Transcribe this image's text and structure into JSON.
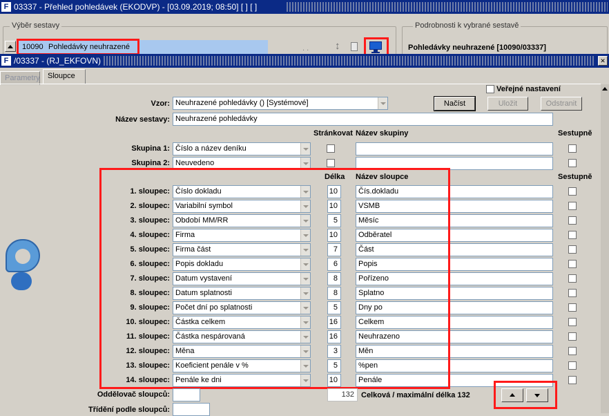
{
  "main_window": {
    "title": "03337 - Přehled pohledávek (EKODVP) - [03.09.2019; 08:50]  [ ]  [ ]"
  },
  "report_select": {
    "label": "Výběr sestavy",
    "code": "10090",
    "name": "Pohledávky neuhrazené"
  },
  "details_panel": {
    "label": "Podrobnosti k vybrané sestavě",
    "title": "Pohledávky neuhrazené [10090/03337]"
  },
  "sub_window": {
    "title": "/03337 - (RJ_EKFOVN)"
  },
  "tabs": [
    {
      "label": "Parametry",
      "active": false
    },
    {
      "label": "Sloupce",
      "active": true
    }
  ],
  "form": {
    "public_settings": "Veřejné nastavení",
    "vzor_label": "Vzor:",
    "vzor_value": "Neuhrazené pohledávky   ()   [Systémové]",
    "btn_load": "Načíst",
    "btn_save": "Uložit",
    "btn_remove": "Odstranit",
    "report_name_label": "Název sestavy:",
    "report_name_value": "Neuhrazené pohledávky",
    "hdr_paging": "Stránkovat",
    "hdr_group_name": "Název skupiny",
    "hdr_desc": "Sestupně",
    "groups": [
      {
        "label": "Skupina 1:",
        "value": "Číslo a název deníku",
        "group_name": ""
      },
      {
        "label": "Skupina 2:",
        "value": "Neuvedeno",
        "group_name": ""
      }
    ],
    "hdr_length": "Délka",
    "hdr_column_name": "Název sloupce",
    "hdr_desc2": "Sestupně",
    "columns": [
      {
        "label": "1. sloupec:",
        "value": "Číslo dokladu",
        "length": "10",
        "name": "Čís.dokladu"
      },
      {
        "label": "2. sloupec:",
        "value": "Variabilní symbol",
        "length": "10",
        "name": "VSMB"
      },
      {
        "label": "3. sloupec:",
        "value": "Období MM/RR",
        "length": "5",
        "name": "Měsíc"
      },
      {
        "label": "4. sloupec:",
        "value": "Firma",
        "length": "10",
        "name": "Odběratel"
      },
      {
        "label": "5. sloupec:",
        "value": "Firma část",
        "length": "7",
        "name": "Část"
      },
      {
        "label": "6. sloupec:",
        "value": "Popis dokladu",
        "length": "6",
        "name": "Popis"
      },
      {
        "label": "7. sloupec:",
        "value": "Datum vystavení",
        "length": "8",
        "name": "Pořízeno"
      },
      {
        "label": "8. sloupec:",
        "value": "Datum splatnosti",
        "length": "8",
        "name": "Splatno"
      },
      {
        "label": "9. sloupec:",
        "value": "Počet dní po splatnosti",
        "length": "5",
        "name": "Dny po"
      },
      {
        "label": "10. sloupec:",
        "value": "Částka celkem",
        "length": "16",
        "name": "Celkem"
      },
      {
        "label": "11. sloupec:",
        "value": "Částka nespárovaná",
        "length": "16",
        "name": "Neuhrazeno"
      },
      {
        "label": "12. sloupec:",
        "value": "Měna",
        "length": "3",
        "name": "Měn"
      },
      {
        "label": "13. sloupec:",
        "value": "Koeficient penále v %",
        "length": "5",
        "name": "%pen"
      },
      {
        "label": "14. sloupec:",
        "value": "Penále ke dni",
        "length": "10",
        "name": "Penále"
      }
    ],
    "separator_label": "Oddělovač sloupců:",
    "separator_value": "",
    "total_length": "132",
    "total_length_label": "Celková / maximální délka 132",
    "sort_label": "Třídění podle sloupců:",
    "sort_value": ""
  },
  "colors": {
    "titlebar": "#0b2a86",
    "window": "#d4d0c8",
    "highlight": "#ff1a1a",
    "selection": "#a8c8ef"
  }
}
